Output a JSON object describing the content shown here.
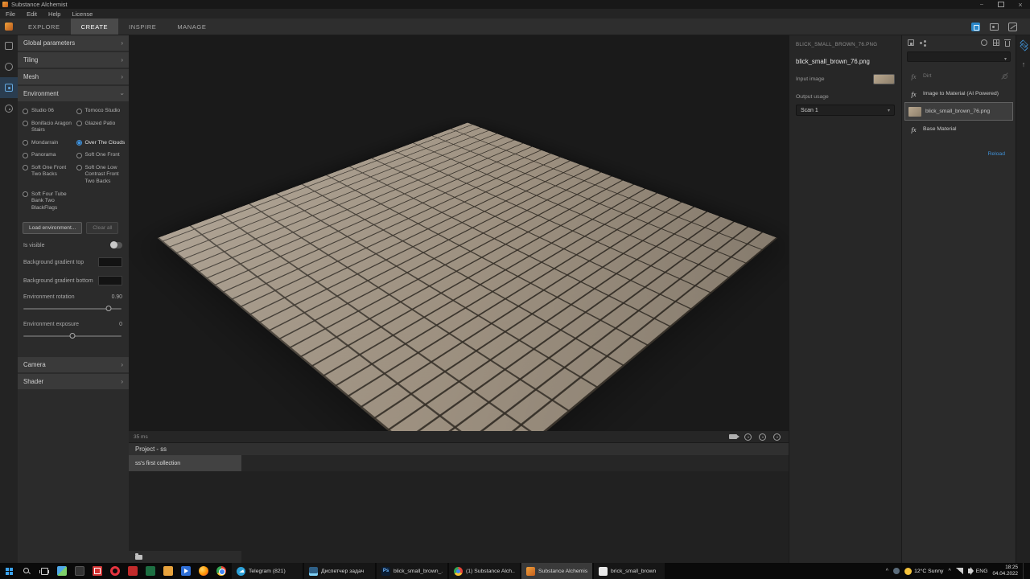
{
  "titlebar": {
    "title": "Substance Alchemist"
  },
  "menubar": {
    "items": [
      {
        "label": "File"
      },
      {
        "label": "Edit"
      },
      {
        "label": "Help"
      },
      {
        "label": "License"
      }
    ]
  },
  "nav": {
    "tabs": [
      {
        "label": "EXPLORE"
      },
      {
        "label": "CREATE"
      },
      {
        "label": "INSPIRE"
      },
      {
        "label": "MANAGE"
      }
    ],
    "active_tab": "CREATE"
  },
  "left_panel": {
    "sections": [
      {
        "label": "Global parameters"
      },
      {
        "label": "Tiling"
      },
      {
        "label": "Mesh"
      },
      {
        "label": "Environment"
      },
      {
        "label": "Camera"
      },
      {
        "label": "Shader"
      }
    ],
    "environment": {
      "options": [
        {
          "label": "Studio 06"
        },
        {
          "label": "Tomoco Studio"
        },
        {
          "label": "Bonifacio Aragon Stairs"
        },
        {
          "label": "Glazed Patio"
        },
        {
          "label": "Mondarrain"
        },
        {
          "label": "Over The Clouds"
        },
        {
          "label": "Panorama"
        },
        {
          "label": "Soft One Front"
        },
        {
          "label": "Soft One Front Two Backs"
        },
        {
          "label": "Soft One Low Contrast Front Two Backs"
        },
        {
          "label": "Soft Four Tube Bank Two BlackFlags"
        }
      ],
      "selected_option": "Over The Clouds",
      "load_button": "Load environment...",
      "clear_button": "Clear all",
      "is_visible_label": "Is visible",
      "bg_gradient_top_label": "Background gradient top",
      "bg_gradient_bottom_label": "Background gradient bottom",
      "rotation_label": "Environment rotation",
      "rotation_value": "0.90",
      "exposure_label": "Environment exposure",
      "exposure_value": "0"
    }
  },
  "viewport": {
    "render_time": "35 ms"
  },
  "project": {
    "title": "Project - ss",
    "collection": "ss's first collection"
  },
  "properties": {
    "header": "BLICK_SMALL_BROWN_76.PNG",
    "filename": "blick_small_brown_76.png",
    "input_image_label": "Input image",
    "output_usage_label": "Output usage",
    "output_usage_value": "Scan 1"
  },
  "layers": {
    "items": [
      {
        "badge": "fx",
        "label": "Dirt",
        "hidden": true
      },
      {
        "badge": "fx",
        "label": "Image to Material (AI Powered)"
      },
      {
        "label": "blick_small_brown_76.png",
        "selected": true
      },
      {
        "badge": "fx",
        "label": "Base Material"
      }
    ],
    "selected_layer": "blick_small_brown_76.png",
    "reload_label": "Reload"
  },
  "taskbar": {
    "buttons": [
      {
        "label": "Telegram (821)"
      },
      {
        "label": "Диспетчер задач"
      },
      {
        "label": "blick_small_brown_...",
        "icon_label": "Ps"
      },
      {
        "label": "(1) Substance Alch..."
      },
      {
        "label": "Substance Alchemist",
        "active": true
      },
      {
        "label": "brick_small_brown"
      }
    ],
    "active_button": "Substance Alchemist",
    "tray": {
      "weather": "12°C Sunny",
      "language": "ENG",
      "time": "18:25",
      "date": "04.04.2022"
    }
  },
  "colors": {
    "accent_blue": "#3f94e0",
    "logo_orange": "#e08a2e",
    "brick_light": "#a39685",
    "mortar_dark": "#363028",
    "reload_blue": "#3f8fd4"
  }
}
